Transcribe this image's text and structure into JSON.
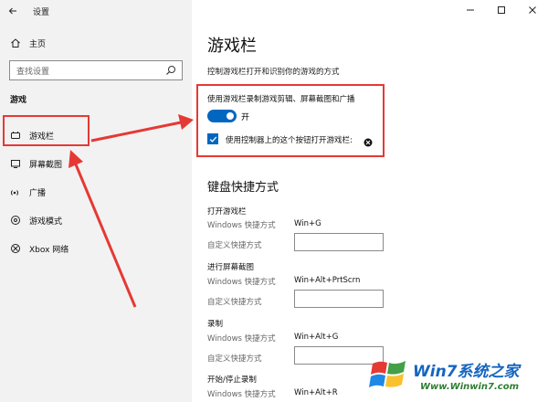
{
  "window": {
    "title": "设置"
  },
  "sidebar": {
    "home_label": "主页",
    "search_placeholder": "查找设置",
    "section_label": "游戏",
    "items": [
      {
        "label": "游戏栏",
        "icon": "gamebar-icon"
      },
      {
        "label": "屏幕截图",
        "icon": "capture-icon"
      },
      {
        "label": "广播",
        "icon": "broadcast-icon"
      },
      {
        "label": "游戏模式",
        "icon": "gamemode-icon"
      },
      {
        "label": "Xbox 网络",
        "icon": "xbox-icon"
      }
    ]
  },
  "main": {
    "title": "游戏栏",
    "description": "控制游戏栏打开和识别你的游戏的方式",
    "record_setting": "使用游戏栏录制游戏剪辑、屏幕截图和广播",
    "toggle": {
      "state": "on",
      "label": "开"
    },
    "controller_checkbox": {
      "checked": true,
      "label": "使用控制器上的这个按钮打开游戏栏:"
    },
    "keyboard_title": "键盘快捷方式",
    "shortcut_groups": [
      {
        "title": "打开游戏栏",
        "windows_label": "Windows 快捷方式",
        "windows_value": "Win+G",
        "custom_label": "自定义快捷方式"
      },
      {
        "title": "进行屏幕截图",
        "windows_label": "Windows 快捷方式",
        "windows_value": "Win+Alt+PrtScrn",
        "custom_label": "自定义快捷方式"
      },
      {
        "title": "录制",
        "windows_label": "Windows 快捷方式",
        "windows_value": "Win+Alt+G",
        "custom_label": "自定义快捷方式"
      },
      {
        "title": "开始/停止录制",
        "windows_label": "Windows 快捷方式",
        "windows_value": "Win+Alt+R"
      }
    ]
  },
  "watermark": {
    "brand": "Win7系统之家",
    "url": "Www.Winwin7.com"
  },
  "colors": {
    "accent": "#0067c0",
    "annotation": "#e53935"
  }
}
